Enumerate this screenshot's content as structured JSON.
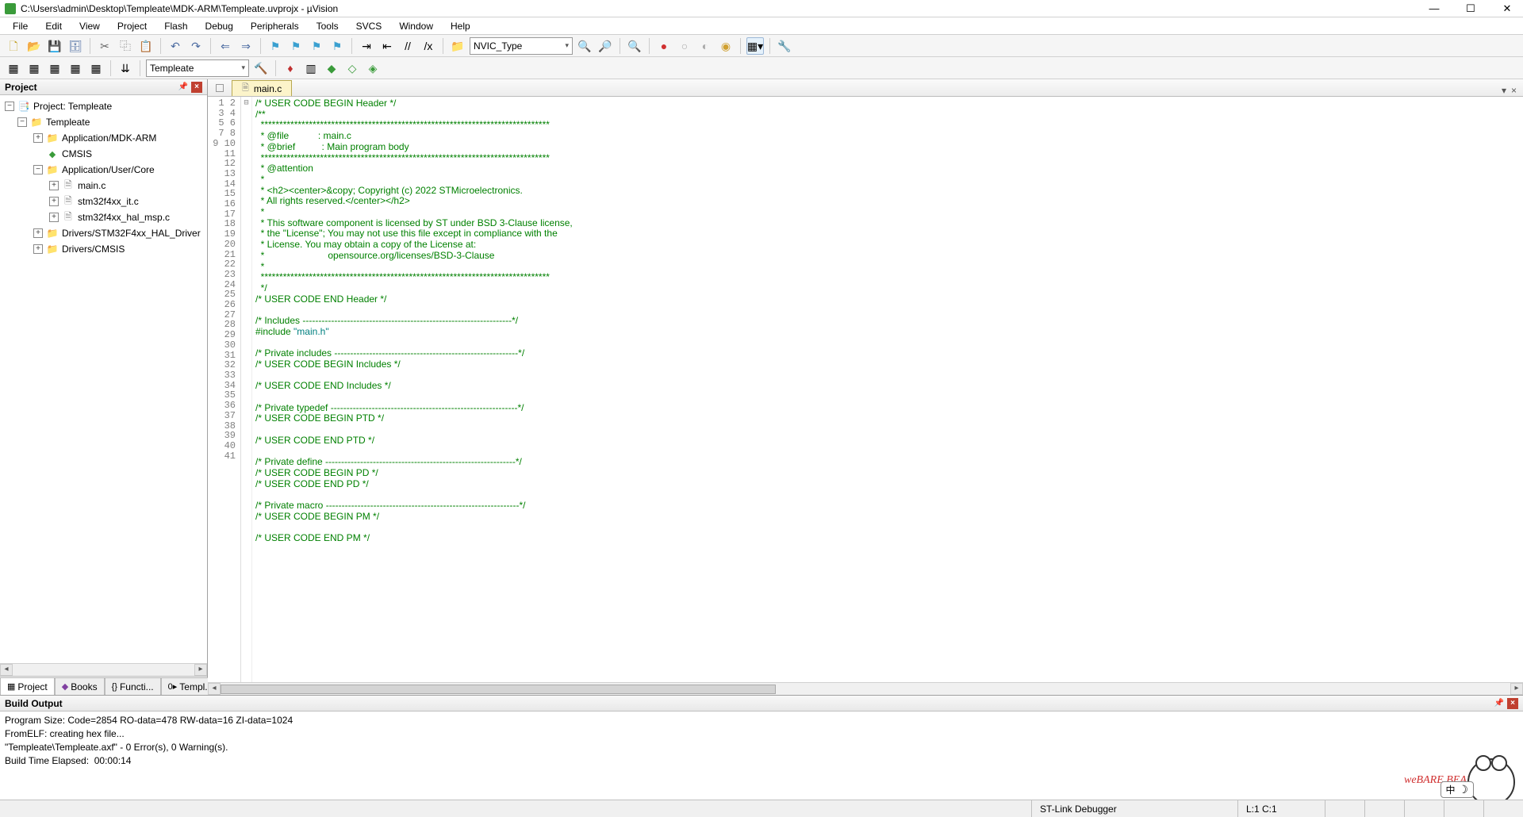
{
  "title": "C:\\Users\\admin\\Desktop\\Templeate\\MDK-ARM\\Templeate.uvprojx - µVision",
  "menu": [
    "File",
    "Edit",
    "View",
    "Project",
    "Flash",
    "Debug",
    "Peripherals",
    "Tools",
    "SVCS",
    "Window",
    "Help"
  ],
  "toolbar1": {
    "combo": "NVIC_Type"
  },
  "toolbar2": {
    "target": "Templeate"
  },
  "project": {
    "title": "Project",
    "root": "Project: Templeate",
    "nodes": {
      "templeate": "Templeate",
      "mdkarm": "Application/MDK-ARM",
      "cmsis": "CMSIS",
      "usercore": "Application/User/Core",
      "main": "main.c",
      "it": "stm32f4xx_it.c",
      "halmsp": "stm32f4xx_hal_msp.c",
      "haldrv": "Drivers/STM32F4xx_HAL_Driver",
      "drvcmsis": "Drivers/CMSIS"
    },
    "tabs": {
      "project": "Project",
      "books": "Books",
      "functions": "Functi...",
      "templates": "Templ..."
    }
  },
  "editor": {
    "tab": "main.c",
    "lines": [
      {
        "n": 1,
        "cls": "c-cmt",
        "t": "/* USER CODE BEGIN Header */"
      },
      {
        "n": 2,
        "cls": "c-cmt",
        "t": "/**"
      },
      {
        "n": 3,
        "cls": "c-cmt",
        "t": "  ******************************************************************************"
      },
      {
        "n": 4,
        "cls": "c-cmt",
        "t": "  * @file           : main.c"
      },
      {
        "n": 5,
        "cls": "c-cmt",
        "t": "  * @brief          : Main program body"
      },
      {
        "n": 6,
        "cls": "c-cmt",
        "t": "  ******************************************************************************"
      },
      {
        "n": 7,
        "cls": "c-cmt",
        "t": "  * @attention"
      },
      {
        "n": 8,
        "cls": "c-cmt",
        "t": "  *"
      },
      {
        "n": 9,
        "cls": "c-cmt",
        "t": "  * <h2><center>&copy; Copyright (c) 2022 STMicroelectronics."
      },
      {
        "n": 10,
        "cls": "c-cmt",
        "t": "  * All rights reserved.</center></h2>"
      },
      {
        "n": 11,
        "cls": "c-cmt",
        "t": "  *"
      },
      {
        "n": 12,
        "cls": "c-cmt",
        "t": "  * This software component is licensed by ST under BSD 3-Clause license,"
      },
      {
        "n": 13,
        "cls": "c-cmt",
        "t": "  * the \"License\"; You may not use this file except in compliance with the"
      },
      {
        "n": 14,
        "cls": "c-cmt",
        "t": "  * License. You may obtain a copy of the License at:"
      },
      {
        "n": 15,
        "cls": "c-cmt",
        "t": "  *                        opensource.org/licenses/BSD-3-Clause"
      },
      {
        "n": 16,
        "cls": "c-cmt",
        "t": "  *"
      },
      {
        "n": 17,
        "cls": "c-cmt",
        "t": "  ******************************************************************************"
      },
      {
        "n": 18,
        "cls": "c-cmt",
        "t": "  */"
      },
      {
        "n": 19,
        "cls": "c-cmt",
        "t": "/* USER CODE END Header */"
      },
      {
        "n": 20,
        "cls": "",
        "t": ""
      },
      {
        "n": 21,
        "cls": "c-cmt",
        "t": "/* Includes ------------------------------------------------------------------*/"
      },
      {
        "n": 22,
        "cls": "",
        "html": "<span class=\"c-pp\">#include </span><span class=\"c-str\">\"main.h\"</span>"
      },
      {
        "n": 23,
        "cls": "",
        "t": ""
      },
      {
        "n": 24,
        "cls": "c-cmt",
        "t": "/* Private includes ----------------------------------------------------------*/"
      },
      {
        "n": 25,
        "cls": "c-cmt",
        "t": "/* USER CODE BEGIN Includes */"
      },
      {
        "n": 26,
        "cls": "",
        "t": ""
      },
      {
        "n": 27,
        "cls": "c-cmt",
        "t": "/* USER CODE END Includes */"
      },
      {
        "n": 28,
        "cls": "",
        "t": ""
      },
      {
        "n": 29,
        "cls": "c-cmt",
        "t": "/* Private typedef -----------------------------------------------------------*/"
      },
      {
        "n": 30,
        "cls": "c-cmt",
        "t": "/* USER CODE BEGIN PTD */"
      },
      {
        "n": 31,
        "cls": "",
        "t": ""
      },
      {
        "n": 32,
        "cls": "c-cmt",
        "t": "/* USER CODE END PTD */"
      },
      {
        "n": 33,
        "cls": "",
        "t": ""
      },
      {
        "n": 34,
        "cls": "c-cmt",
        "t": "/* Private define ------------------------------------------------------------*/"
      },
      {
        "n": 35,
        "cls": "c-cmt",
        "t": "/* USER CODE BEGIN PD */"
      },
      {
        "n": 36,
        "cls": "c-cmt",
        "t": "/* USER CODE END PD */"
      },
      {
        "n": 37,
        "cls": "",
        "t": ""
      },
      {
        "n": 38,
        "cls": "c-cmt",
        "t": "/* Private macro -------------------------------------------------------------*/"
      },
      {
        "n": 39,
        "cls": "c-cmt",
        "t": "/* USER CODE BEGIN PM */"
      },
      {
        "n": 40,
        "cls": "",
        "t": ""
      },
      {
        "n": 41,
        "cls": "c-cmt",
        "t": "/* USER CODE END PM */"
      }
    ]
  },
  "build": {
    "title": "Build Output",
    "text": "Program Size: Code=2854 RO-data=478 RW-data=16 ZI-data=1024\nFromELF: creating hex file...\n\"Templeate\\Templeate.axf\" - 0 Error(s), 0 Warning(s).\nBuild Time Elapsed:  00:00:14",
    "sticker": "weBARE BEARS",
    "ime": "中"
  },
  "status": {
    "debugger": "ST-Link Debugger",
    "pos": "L:1 C:1"
  }
}
